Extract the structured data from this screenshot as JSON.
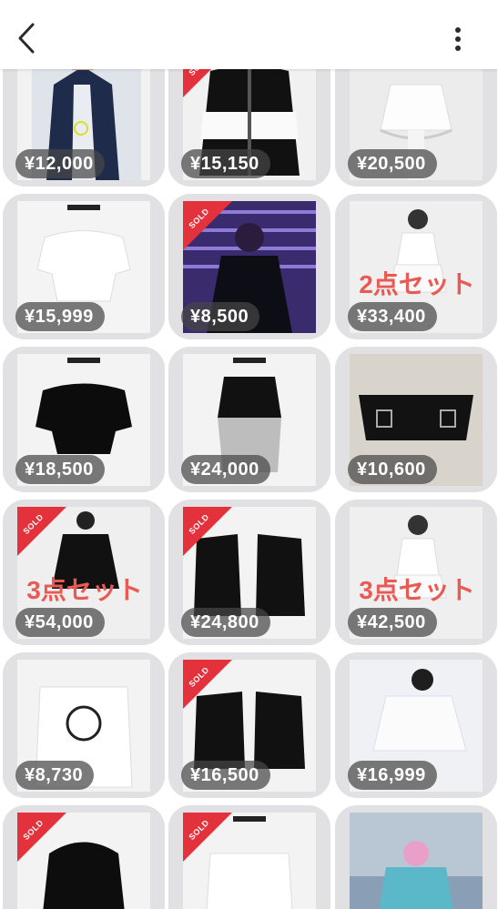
{
  "header": {
    "back_icon": "chevron-left-icon",
    "more_icon": "vertical-dots-icon"
  },
  "sold_label": "SOLD",
  "listings": [
    {
      "price": "¥12,000",
      "sold": false,
      "overlay": ""
    },
    {
      "price": "¥15,150",
      "sold": true,
      "overlay": ""
    },
    {
      "price": "¥20,500",
      "sold": false,
      "overlay": ""
    },
    {
      "price": "¥15,999",
      "sold": false,
      "overlay": ""
    },
    {
      "price": "¥8,500",
      "sold": true,
      "overlay": ""
    },
    {
      "price": "¥33,400",
      "sold": false,
      "overlay": "2点セット"
    },
    {
      "price": "¥18,500",
      "sold": false,
      "overlay": ""
    },
    {
      "price": "¥24,000",
      "sold": false,
      "overlay": ""
    },
    {
      "price": "¥10,600",
      "sold": false,
      "overlay": ""
    },
    {
      "price": "¥54,000",
      "sold": true,
      "overlay": "3点セット"
    },
    {
      "price": "¥24,800",
      "sold": true,
      "overlay": ""
    },
    {
      "price": "¥42,500",
      "sold": false,
      "overlay": "3点セット"
    },
    {
      "price": "¥8,730",
      "sold": false,
      "overlay": ""
    },
    {
      "price": "¥16,500",
      "sold": true,
      "overlay": ""
    },
    {
      "price": "¥16,999",
      "sold": false,
      "overlay": ""
    },
    {
      "price": "",
      "sold": true,
      "overlay": ""
    },
    {
      "price": "",
      "sold": true,
      "overlay": ""
    },
    {
      "price": "",
      "sold": false,
      "overlay": ""
    }
  ]
}
